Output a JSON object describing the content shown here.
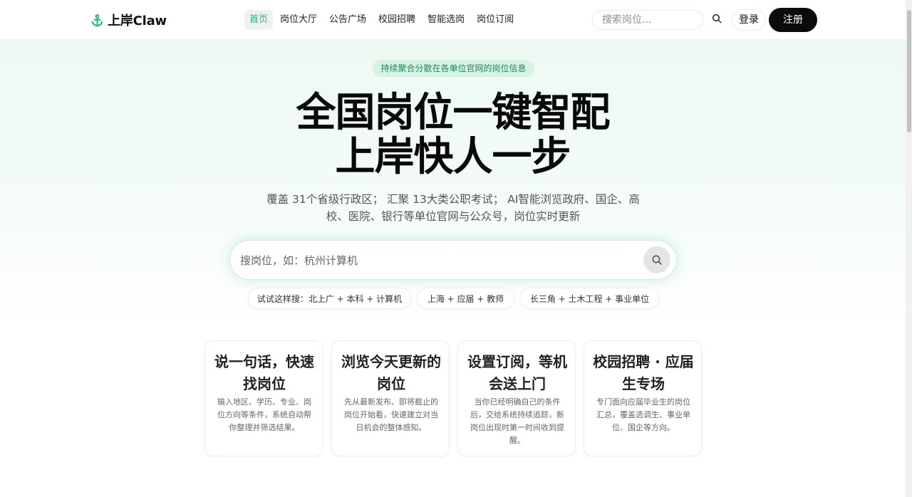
{
  "brand": {
    "name": "上岸Claw",
    "accent": "#2fb57a"
  },
  "nav": {
    "items": [
      {
        "label": "首页",
        "active": true
      },
      {
        "label": "岗位大厅"
      },
      {
        "label": "公告广场"
      },
      {
        "label": "校园招聘"
      },
      {
        "label": "智能选岗"
      },
      {
        "label": "岗位订阅"
      }
    ]
  },
  "header": {
    "search_placeholder": "搜索岗位...",
    "login_label": "登录",
    "register_label": "注册"
  },
  "hero": {
    "pill": "持续聚合分散在各单位官网的岗位信息",
    "title_line1": "全国岗位一键智配",
    "title_line2": "上岸快人一步",
    "subtitle": "覆盖 31个省级行政区； 汇聚 13大类公职考试； AI智能浏览政府、国企、高校、医院、银行等单位官网与公众号，岗位实时更新",
    "search_placeholder": "搜岗位，如：杭州计算机",
    "suggestions": [
      "试试这样搜：北上广 + 本科 + 计算机",
      "上海 + 应届 + 教师",
      "长三角 + 土木工程 + 事业单位"
    ]
  },
  "features": [
    {
      "title": "说一句话，快速找岗位",
      "desc": "输入地区、学历、专业、岗位方向等条件，系统自动帮你整理并筛选结果。"
    },
    {
      "title": "浏览今天更新的岗位",
      "desc": "先从最新发布、即将截止的岗位开始看，快速建立对当日机会的整体感知。"
    },
    {
      "title": "设置订阅，等机会送上门",
      "desc": "当你已经明确自己的条件后，交给系统持续追踪，新岗位出现时第一时间收到提醒。"
    },
    {
      "title": "校园招聘 · 应届生专场",
      "desc": "专门面向应届毕业生的岗位汇总，覆盖选调生、事业单位、国企等方向。"
    }
  ]
}
